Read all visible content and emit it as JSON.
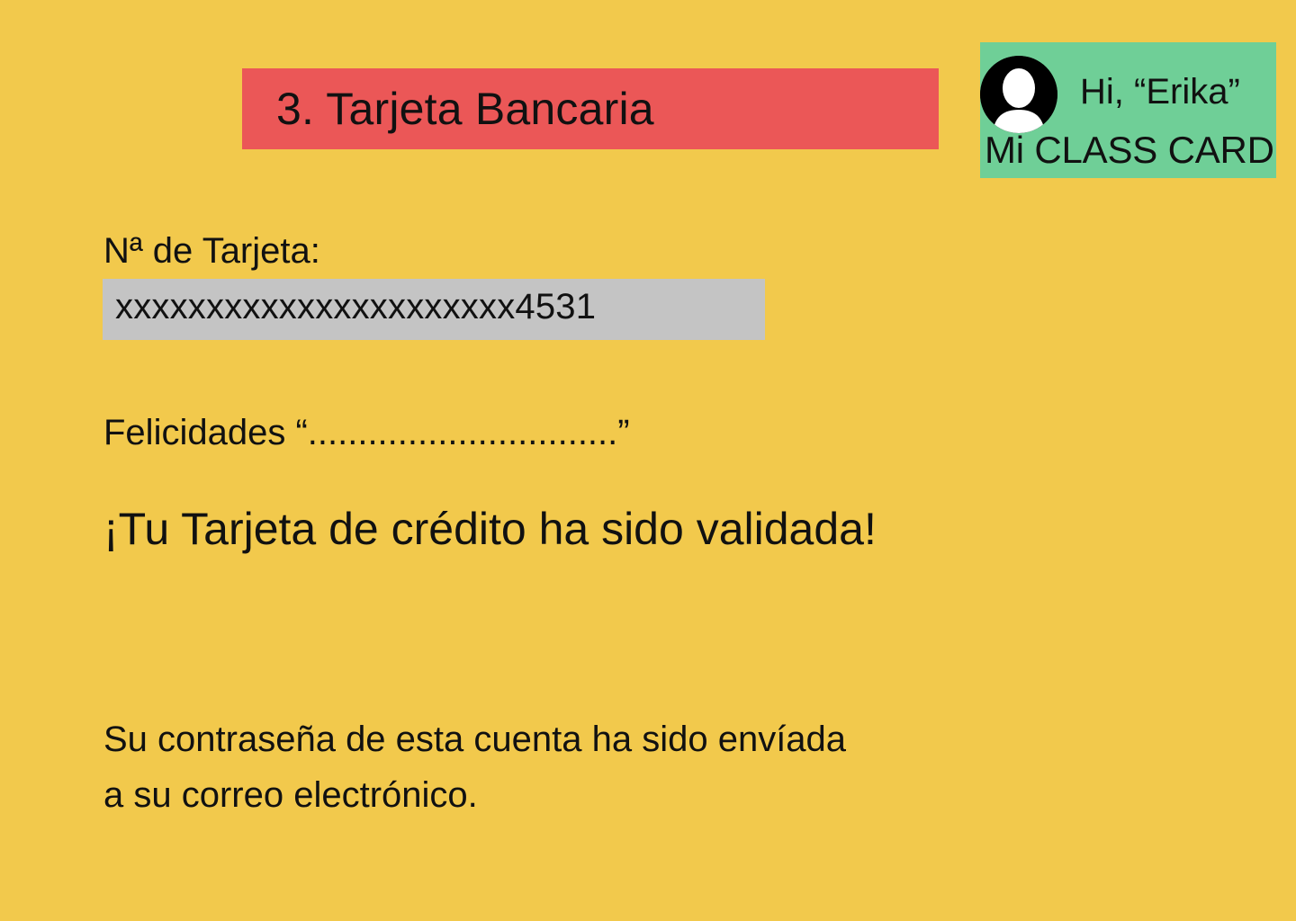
{
  "header": {
    "step_title": "3. Tarjeta Bancaria"
  },
  "user_card": {
    "greeting": "Hi, “Erika”",
    "card_name": "Mi CLASS CARD",
    "avatar_icon": "user-silhouette-icon"
  },
  "card_form": {
    "number_label": "Nª de Tarjeta:",
    "number_value": "xxxxxxxxxxxxxxxxxxxxxx4531"
  },
  "messages": {
    "congrats": "Felicidades “...............................”",
    "validated": "¡Tu Tarjeta de crédito ha sido validada!",
    "password_line1": "Su contraseña de esta cuenta ha sido envíada",
    "password_line2": "a su correo electrónico."
  },
  "colors": {
    "background": "#F2C94C",
    "step_banner": "#EB5757",
    "user_card": "#6FCF97",
    "input_field": "#C4C4C4"
  }
}
